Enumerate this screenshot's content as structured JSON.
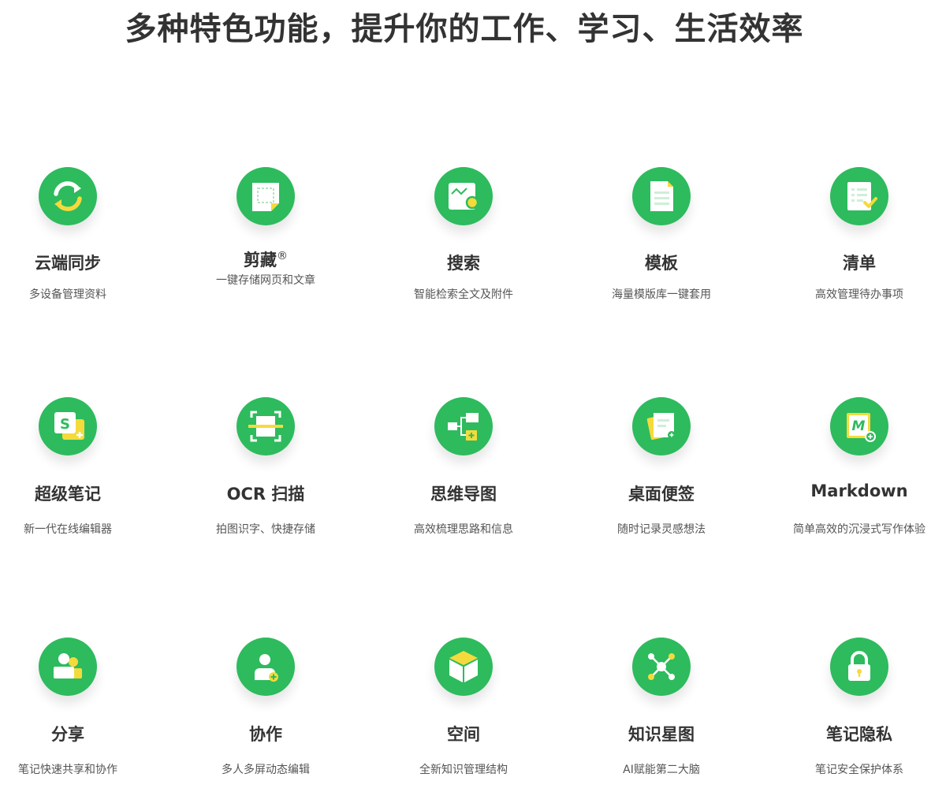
{
  "page_title": "多种特色功能，提升你的工作、学习、生活效率",
  "colors": {
    "accent_green": "#2DBB5D",
    "accent_yellow": "#F5DA3C",
    "text_dark": "#333333",
    "text_muted": "#555555"
  },
  "features": [
    {
      "title": "云端同步",
      "desc": "多设备管理资料",
      "icon": "sync-icon"
    },
    {
      "title": "剪藏",
      "title_mark": "®",
      "desc": "一键存储网页和文章",
      "icon": "clip-icon"
    },
    {
      "title": "搜索",
      "desc": "智能检索全文及附件",
      "icon": "search-icon"
    },
    {
      "title": "模板",
      "desc": "海量模版库一键套用",
      "icon": "template-icon"
    },
    {
      "title": "清单",
      "desc": "高效管理待办事项",
      "icon": "checklist-icon"
    },
    {
      "title": "超级笔记",
      "desc": "新一代在线编辑器",
      "icon": "super-note-icon"
    },
    {
      "title": "OCR 扫描",
      "desc": "拍图识字、快捷存储",
      "icon": "scan-icon"
    },
    {
      "title": "思维导图",
      "desc": "高效梳理思路和信息",
      "icon": "mindmap-icon"
    },
    {
      "title": "桌面便签",
      "desc": "随时记录灵感想法",
      "icon": "sticky-note-icon"
    },
    {
      "title": "Markdown",
      "desc": "简单高效的沉浸式写作体验",
      "icon": "markdown-icon"
    },
    {
      "title": "分享",
      "desc": "笔记快速共享和协作",
      "icon": "share-icon"
    },
    {
      "title": "协作",
      "desc": "多人多屏动态编辑",
      "icon": "collaborate-icon"
    },
    {
      "title": "空间",
      "desc": "全新知识管理结构",
      "icon": "space-cube-icon"
    },
    {
      "title": "知识星图",
      "desc": "AI赋能第二大脑",
      "icon": "knowledge-graph-icon"
    },
    {
      "title": "笔记隐私",
      "desc": "笔记安全保护体系",
      "icon": "lock-icon"
    }
  ]
}
